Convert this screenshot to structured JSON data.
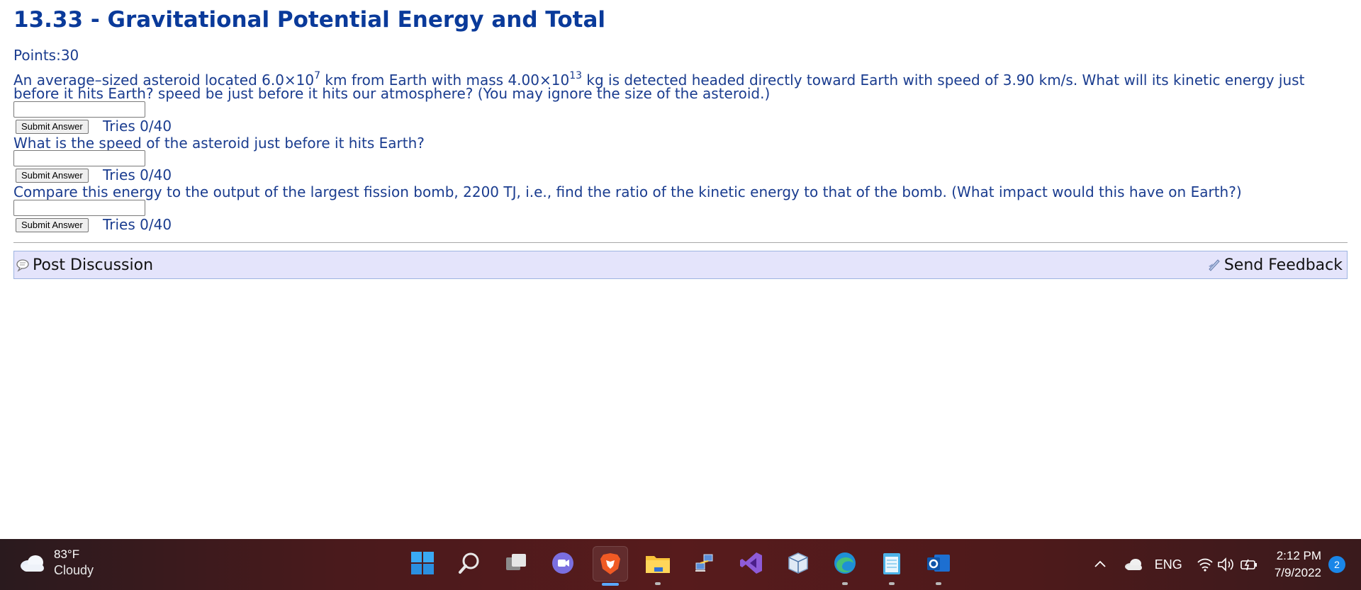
{
  "title": "13.33 - Gravitational Potential Energy and Total",
  "points": "Points:30",
  "question1": {
    "p1": "An average–sized asteroid located 6.0×10",
    "exp1": "7",
    "p2": " km from Earth with mass 4.00×10",
    "exp2": "13",
    "p3": " kg is detected headed directly toward Earth with speed of 3.90 km/s. What will its kinetic energy just before it hits Earth? speed be just before it hits our atmosphere? (You may ignore the size of the asteroid.)"
  },
  "question2": "What is the speed of the asteroid just before it hits Earth?",
  "question3": "Compare this energy to the output of the largest fission bomb, 2200 TJ, i.e., find the ratio of the kinetic energy to that of the bomb. (What impact would this have on Earth?)",
  "submit_label": "Submit Answer",
  "tries": [
    "Tries 0/40",
    "Tries 0/40",
    "Tries 0/40"
  ],
  "answers": [
    "",
    "",
    ""
  ],
  "footer": {
    "post_discussion": "Post Discussion",
    "send_feedback": "Send Feedback"
  },
  "taskbar": {
    "weather_temp": "83°F",
    "weather_cond": "Cloudy",
    "language": "ENG",
    "time": "2:12 PM",
    "date": "7/9/2022",
    "notifications": "2",
    "apps": [
      "start-icon",
      "search-icon",
      "task-view-icon",
      "chat-icon",
      "brave-browser-icon",
      "file-explorer-icon",
      "network-app-icon",
      "visual-studio-icon",
      "virtualbox-icon",
      "edge-browser-icon",
      "notepad-icon",
      "outlook-icon"
    ]
  },
  "colors": {
    "text": "#1a3c8f",
    "title": "#0a3a9a",
    "feedback_bar": "#e4e4fb"
  }
}
